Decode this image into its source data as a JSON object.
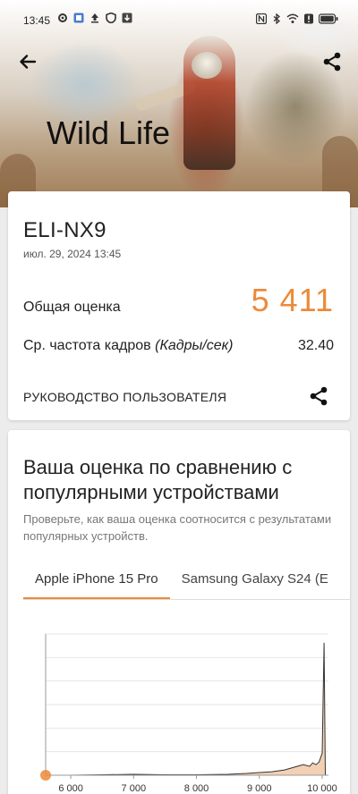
{
  "status_bar": {
    "time": "13:45",
    "left_icons": [
      "gear-icon",
      "app-icon",
      "upload-icon",
      "shield-icon",
      "download-box-icon"
    ],
    "right_icons": [
      "nfc-icon",
      "bluetooth-icon",
      "wifi-icon",
      "alert-icon",
      "battery-icon"
    ]
  },
  "hero": {
    "title": "Wild Life"
  },
  "result": {
    "device_name": "ELI-NX9",
    "date": "июл. 29, 2024 13:45",
    "score_label": "Общая оценка",
    "score_value": "5 411",
    "fps_label": "Ср. частота кадров",
    "fps_unit": "(Кадры/сек)",
    "fps_value": "32.40",
    "guide_label": "РУКОВОДСТВО ПОЛЬЗОВАТЕЛЯ"
  },
  "comparison": {
    "title": "Ваша оценка по сравнению с популярными устройствами",
    "subtitle": "Проверьте, как ваша оценка соотносится с результатами популярных устройств.",
    "tabs": [
      {
        "label": "Apple iPhone 15 Pro",
        "active": true
      },
      {
        "label": "Samsung Galaxy S24 (E",
        "active": false
      }
    ]
  },
  "colors": {
    "accent": "#ec8a3a",
    "fill": "#f3d0b4"
  },
  "chart_data": {
    "type": "area",
    "x_ticks": [
      "6 000",
      "7 000",
      "8 000",
      "9 000",
      "10 000"
    ],
    "x_tick_values": [
      6000,
      7000,
      8000,
      9000,
      10000
    ],
    "xlim": [
      5600,
      10100
    ],
    "x": [
      5600,
      6000,
      6500,
      7000,
      7500,
      8000,
      8500,
      8800,
      9000,
      9200,
      9400,
      9500,
      9600,
      9700,
      9800,
      9850,
      9900,
      9950,
      10000,
      10030,
      10050
    ],
    "y": [
      0,
      0,
      0.5,
      1,
      0.5,
      0.5,
      1,
      2,
      3,
      4,
      6,
      8,
      10,
      12,
      10,
      14,
      12,
      15,
      25,
      150,
      0
    ],
    "ylim": [
      0,
      160
    ],
    "marker": {
      "x": 5411,
      "y": 0
    },
    "grid": true
  }
}
